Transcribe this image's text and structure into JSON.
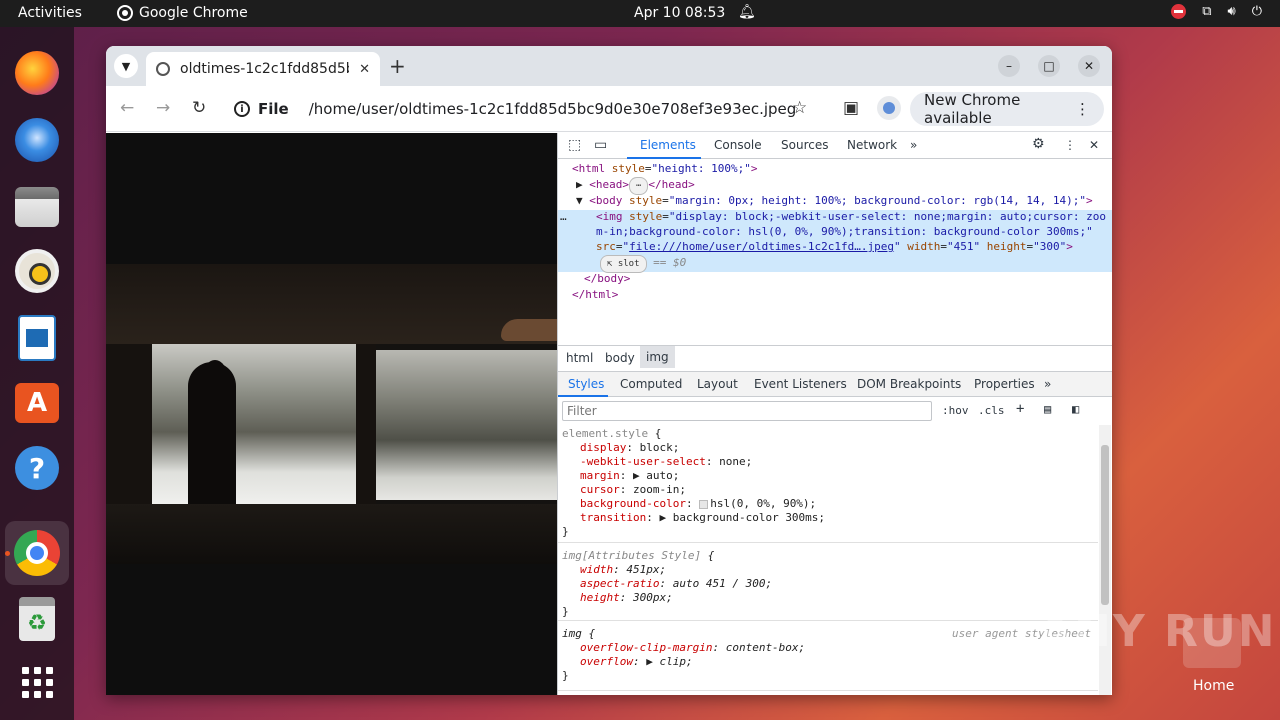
{
  "topbar": {
    "activities": "Activities",
    "app_name": "Google Chrome",
    "clock": "Apr 10  08:53"
  },
  "dock": {
    "items": [
      "firefox",
      "thunderbird",
      "files",
      "rhythmbox",
      "libreoffice-writer",
      "app-center",
      "help",
      "google-chrome",
      "trash",
      "show-apps"
    ]
  },
  "browser": {
    "tab_title": "oldtimes-1c2c1fdd85d5b",
    "scheme": "File",
    "url": "/home/user/oldtimes-1c2c1fdd85d5bc9d0e30e708ef3e93ec.jpeg",
    "update_label": "New Chrome available"
  },
  "devtools": {
    "tabs": [
      "Elements",
      "Console",
      "Sources",
      "Network"
    ],
    "dom": {
      "l1_tag": "<html ",
      "l1_attr": "style",
      "l1_val": "\"height: 100%;\"",
      "l1_end": ">",
      "l2": "<head>",
      "l2_end": "</head>",
      "l3_tag": "<body ",
      "l3_attr": "style",
      "l3_val": "\"margin: 0px; height: 100%; background-color: rgb(14, 14, 14);\"",
      "l3_end": ">",
      "l4_tag": "<img ",
      "l4_attr": "style",
      "l4_val": "\"display: block;-webkit-user-select: none;margin: auto;cursor: zoo",
      "l5_val": "m-in;background-color: hsl(0, 0%, 90%);transition: background-color 300ms;\"",
      "l6_attr1": "src",
      "l6_link": "file:///home/user/oldtimes-1c2c1fd….jpeg",
      "l6_attr2": " width",
      "l6_val2": "\"451\"",
      "l6_attr3": " height",
      "l6_val3": "\"300\"",
      "l6_end": ">",
      "slot": "slot",
      "eq": "== $0",
      "l8": "</body>",
      "l9": "</html>"
    },
    "breadcrumbs": [
      "html",
      "body",
      "img"
    ],
    "subtabs": [
      "Styles",
      "Computed",
      "Layout",
      "Event Listeners",
      "DOM Breakpoints",
      "Properties"
    ],
    "filter_placeholder": "Filter",
    "hov": ":hov",
    "cls": ".cls",
    "rules": {
      "element_style": {
        "selector": "element.style",
        "open": " {",
        "props": [
          {
            "name": "display",
            "value": "block;"
          },
          {
            "name": "-webkit-user-select",
            "value": "none;"
          },
          {
            "name": "margin",
            "value": "▶ auto;"
          },
          {
            "name": "cursor",
            "value": "zoom-in;"
          },
          {
            "name": "background-color",
            "value": "hsl(0, 0%, 90%);"
          },
          {
            "name": "transition",
            "value": "▶ background-color 300ms;"
          }
        ],
        "close": "}"
      },
      "attr_style": {
        "selector": "img[Attributes Style]",
        "open": " {",
        "props": [
          {
            "name": "width",
            "value": "451px;"
          },
          {
            "name": "aspect-ratio",
            "value": "auto 451 / 300;"
          },
          {
            "name": "height",
            "value": "300px;"
          }
        ],
        "close": "}"
      },
      "ua": {
        "selector": "img",
        "open": " {",
        "source": "user agent stylesheet",
        "props": [
          {
            "name": "overflow-clip-margin",
            "value": "content-box;"
          },
          {
            "name": "overflow",
            "value": "▶ clip;"
          }
        ],
        "close": "}"
      }
    }
  },
  "watermark": "ANY RUN",
  "home_label": "Home"
}
